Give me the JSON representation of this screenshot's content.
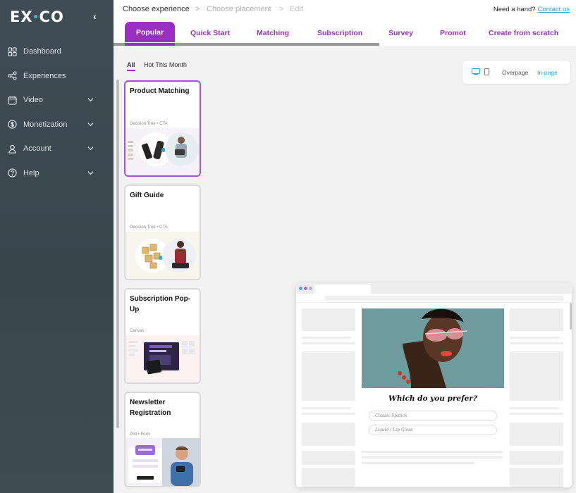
{
  "brand": {
    "logo_text_left": "EX",
    "logo_dot": "·",
    "logo_text_right": "CO"
  },
  "sidebar": {
    "collapse_icon": "chevron-left-icon",
    "items": [
      {
        "label": "Dashboard",
        "icon": "grid-icon",
        "has_submenu": false
      },
      {
        "label": "Experiences",
        "icon": "share-nodes-icon",
        "has_submenu": false
      },
      {
        "label": "Video",
        "icon": "video-calendar-icon",
        "has_submenu": true
      },
      {
        "label": "Monetization",
        "icon": "dollar-circle-icon",
        "has_submenu": true
      },
      {
        "label": "Account",
        "icon": "user-icon",
        "has_submenu": true
      },
      {
        "label": "Help",
        "icon": "question-circle-icon",
        "has_submenu": true
      }
    ]
  },
  "breadcrumb": {
    "steps": [
      "Choose experience",
      "Choose placement",
      "Edit"
    ],
    "separator": ">"
  },
  "help": {
    "text": "Need a hand?",
    "link": "Contact us"
  },
  "tabs": [
    "Popular",
    "Quick Start",
    "Matching",
    "Subscription",
    "Survey",
    "Promot",
    "Create from scratch"
  ],
  "filters": [
    "All",
    "Hot This Month"
  ],
  "cards": [
    {
      "title": "Product Matching",
      "subtitle": "Decision Tree • CTA"
    },
    {
      "title": "Gift Guide",
      "subtitle": "Decision Tree • CTA"
    },
    {
      "title": "Subscription Pop-Up",
      "subtitle": "Canvas"
    },
    {
      "title": "Newsletter Registration",
      "subtitle": "Poll • Form"
    }
  ],
  "device_panel": {
    "desktop_icon": "desktop-icon",
    "mobile_icon": "mobile-icon",
    "overpage": "Overpage",
    "inpage": "In-page"
  },
  "preview": {
    "question": "Which do you prefer?",
    "options": [
      "Classic lipstick",
      "Liquid / Lip Gloss"
    ]
  },
  "colors": {
    "accent": "#9a2fc3",
    "link": "#18a7d8",
    "sidebar": "#3f4c55"
  }
}
